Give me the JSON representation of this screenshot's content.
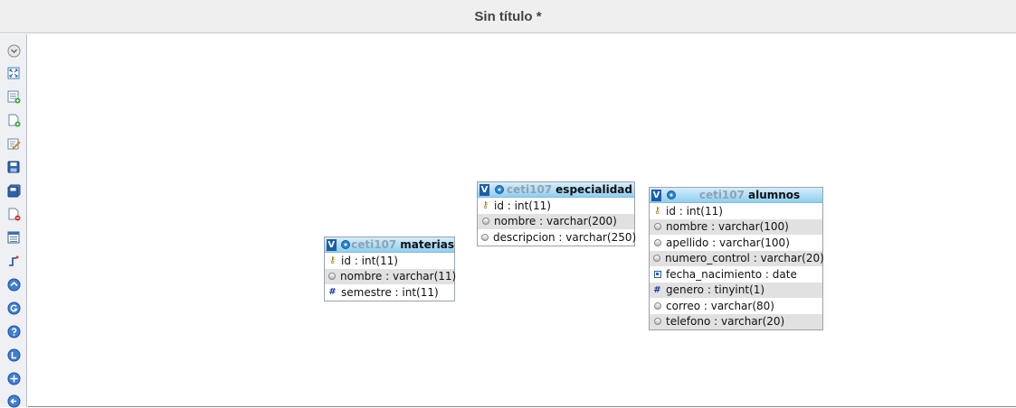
{
  "window": {
    "title": "Sin título *"
  },
  "toolbar": {
    "buttons": [
      {
        "icon": "toggle-menu-icon"
      },
      {
        "icon": "fullscreen-icon"
      },
      {
        "icon": "add-table-icon"
      },
      {
        "icon": "new-page-icon"
      },
      {
        "icon": "edit-page-icon"
      },
      {
        "icon": "save-icon"
      },
      {
        "icon": "save-as-icon"
      },
      {
        "icon": "delete-page-icon"
      },
      {
        "icon": "tables-list-icon"
      },
      {
        "icon": "relation-lines-icon"
      },
      {
        "icon": "angular-links-icon"
      },
      {
        "icon": "snap-grid-icon"
      },
      {
        "icon": "help-icon"
      },
      {
        "icon": "small-size-icon"
      },
      {
        "icon": "toggle-all-icon"
      },
      {
        "icon": "export-icon"
      }
    ]
  },
  "tables": {
    "materias": {
      "db": "ceti107",
      "name": "materias",
      "columns": [
        {
          "text": "id : int(11)",
          "icon": "key"
        },
        {
          "text": "nombre : varchar(11)",
          "icon": "text"
        },
        {
          "text": "semestre : int(11)",
          "icon": "number"
        }
      ]
    },
    "especialidad": {
      "db": "ceti107",
      "name": "especialidad",
      "columns": [
        {
          "text": "id : int(11)",
          "icon": "key"
        },
        {
          "text": "nombre : varchar(200)",
          "icon": "text"
        },
        {
          "text": "descripcion : varchar(250)",
          "icon": "text"
        }
      ]
    },
    "alumnos": {
      "db": "ceti107",
      "name": "alumnos",
      "columns": [
        {
          "text": "id : int(11)",
          "icon": "key"
        },
        {
          "text": "nombre : varchar(100)",
          "icon": "text"
        },
        {
          "text": "apellido : varchar(100)",
          "icon": "text"
        },
        {
          "text": "numero_control : varchar(20)",
          "icon": "text"
        },
        {
          "text": "fecha_nacimiento : date",
          "icon": "date"
        },
        {
          "text": "genero : tinyint(1)",
          "icon": "number"
        },
        {
          "text": "correo : varchar(80)",
          "icon": "text"
        },
        {
          "text": "telefono : varchar(20)",
          "icon": "text"
        }
      ]
    }
  },
  "colors": {
    "header_start": "#d6ecf9",
    "header_end": "#8fd0f1",
    "toggle_button": "#1d5da8",
    "db_name": "#8fa2b1",
    "alt_row": "#e1e1e1"
  }
}
